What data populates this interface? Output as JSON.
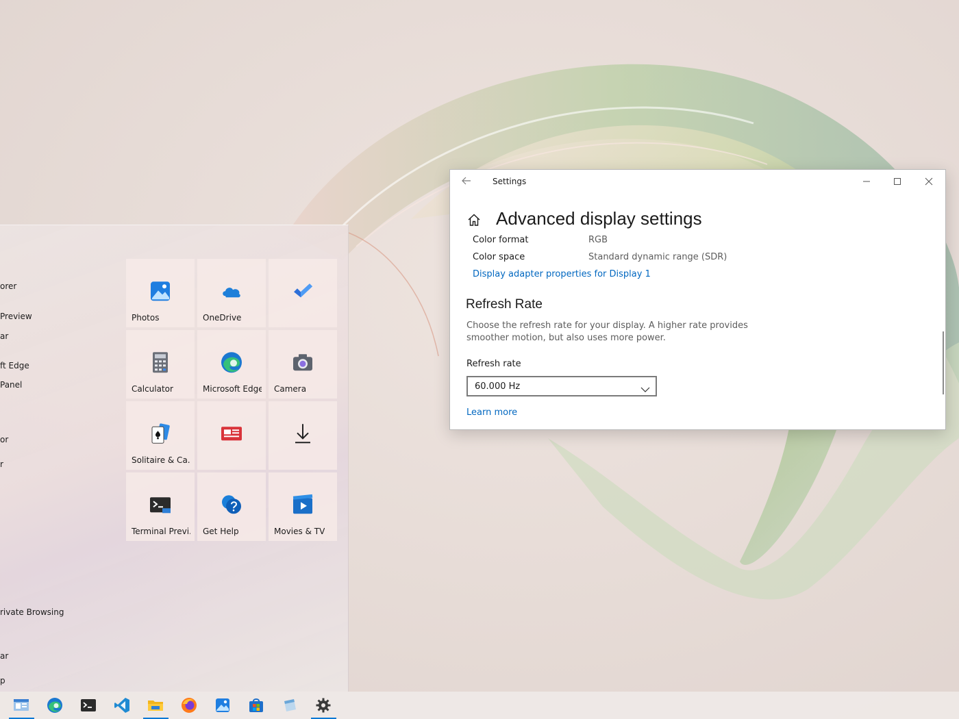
{
  "start_menu": {
    "app_list": [
      {
        "label": "orer"
      },
      {
        "label": " Preview"
      },
      {
        "label": "ar"
      },
      {
        "label": "ft Edge"
      },
      {
        "label": "Panel"
      },
      {
        "label": "or"
      },
      {
        "label": "r"
      },
      {
        "label": "rivate Browsing"
      },
      {
        "label": "ar"
      },
      {
        "label": "p"
      }
    ],
    "tiles": [
      {
        "label": "Photos",
        "icon": "photos-icon"
      },
      {
        "label": "OneDrive",
        "icon": "onedrive-icon"
      },
      {
        "label": "",
        "icon": "todo-icon"
      },
      {
        "label": "Calculator",
        "icon": "calculator-icon"
      },
      {
        "label": "Microsoft Edge",
        "icon": "edge-icon"
      },
      {
        "label": "Camera",
        "icon": "camera-icon"
      },
      {
        "label": "Solitaire & Ca...",
        "icon": "solitaire-icon"
      },
      {
        "label": "",
        "icon": "news-icon"
      },
      {
        "label": "",
        "icon": "download-icon"
      },
      {
        "label": "Terminal Previ...",
        "icon": "terminal-icon"
      },
      {
        "label": "Get Help",
        "icon": "get-help-icon"
      },
      {
        "label": "Movies & TV",
        "icon": "movies-tv-icon"
      }
    ]
  },
  "settings": {
    "window_title": "Settings",
    "page_title": "Advanced display settings",
    "properties": [
      {
        "label": "Color format",
        "value": "RGB"
      },
      {
        "label": "Color space",
        "value": "Standard dynamic range (SDR)"
      }
    ],
    "adapter_link": "Display adapter properties for Display 1",
    "refresh_section": {
      "heading": "Refresh Rate",
      "description": "Choose the refresh rate for your display. A higher rate provides smoother motion, but also uses more power.",
      "field_label": "Refresh rate",
      "selected_value": "60.000 Hz",
      "learn_more": "Learn more"
    }
  },
  "taskbar": {
    "items": [
      {
        "icon": "start-icon",
        "active": true
      },
      {
        "icon": "edge-icon",
        "active": false
      },
      {
        "icon": "terminal-icon",
        "active": false
      },
      {
        "icon": "vscode-icon",
        "active": false
      },
      {
        "icon": "file-explorer-icon",
        "active": true
      },
      {
        "icon": "firefox-icon",
        "active": false
      },
      {
        "icon": "photos-icon",
        "active": false
      },
      {
        "icon": "store-icon",
        "active": false
      },
      {
        "icon": "notepad-icon",
        "active": false
      },
      {
        "icon": "settings-icon",
        "active": true
      }
    ],
    "accent_color": "#0078d4"
  },
  "colors": {
    "link": "#0067c0",
    "accent": "#0078d4"
  }
}
